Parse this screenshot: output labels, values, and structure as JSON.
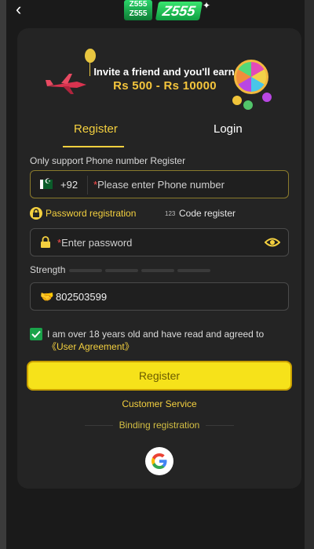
{
  "header": {
    "back_icon": "chevron-left-icon",
    "logo_small": "Z555",
    "logo_small_sub": "Z555",
    "logo_big": "Z555"
  },
  "banner": {
    "line1": "Invite a friend and you'll earn",
    "line2": "Rs 500 - Rs 10000"
  },
  "tabs": {
    "register": "Register",
    "login": "Login"
  },
  "form": {
    "hint": "Only support Phone number Register",
    "country_code": "+92",
    "phone_placeholder": "Please enter Phone number",
    "password_registration": "Password registration",
    "code_icon_text": "123",
    "code_register": "Code register",
    "password_placeholder": "Enter password",
    "strength_label": "Strength",
    "invite_code": "802503599",
    "agreement_text": "I am over 18 years old and have read and agreed to ",
    "agreement_link": "《User Agreement》",
    "agreement_checked": true
  },
  "actions": {
    "register": "Register",
    "customer_service": "Customer Service",
    "binding_registration": "Binding registration"
  },
  "colors": {
    "accent": "#f4d03f",
    "button": "#f6e21a",
    "check": "#1aa34a"
  }
}
